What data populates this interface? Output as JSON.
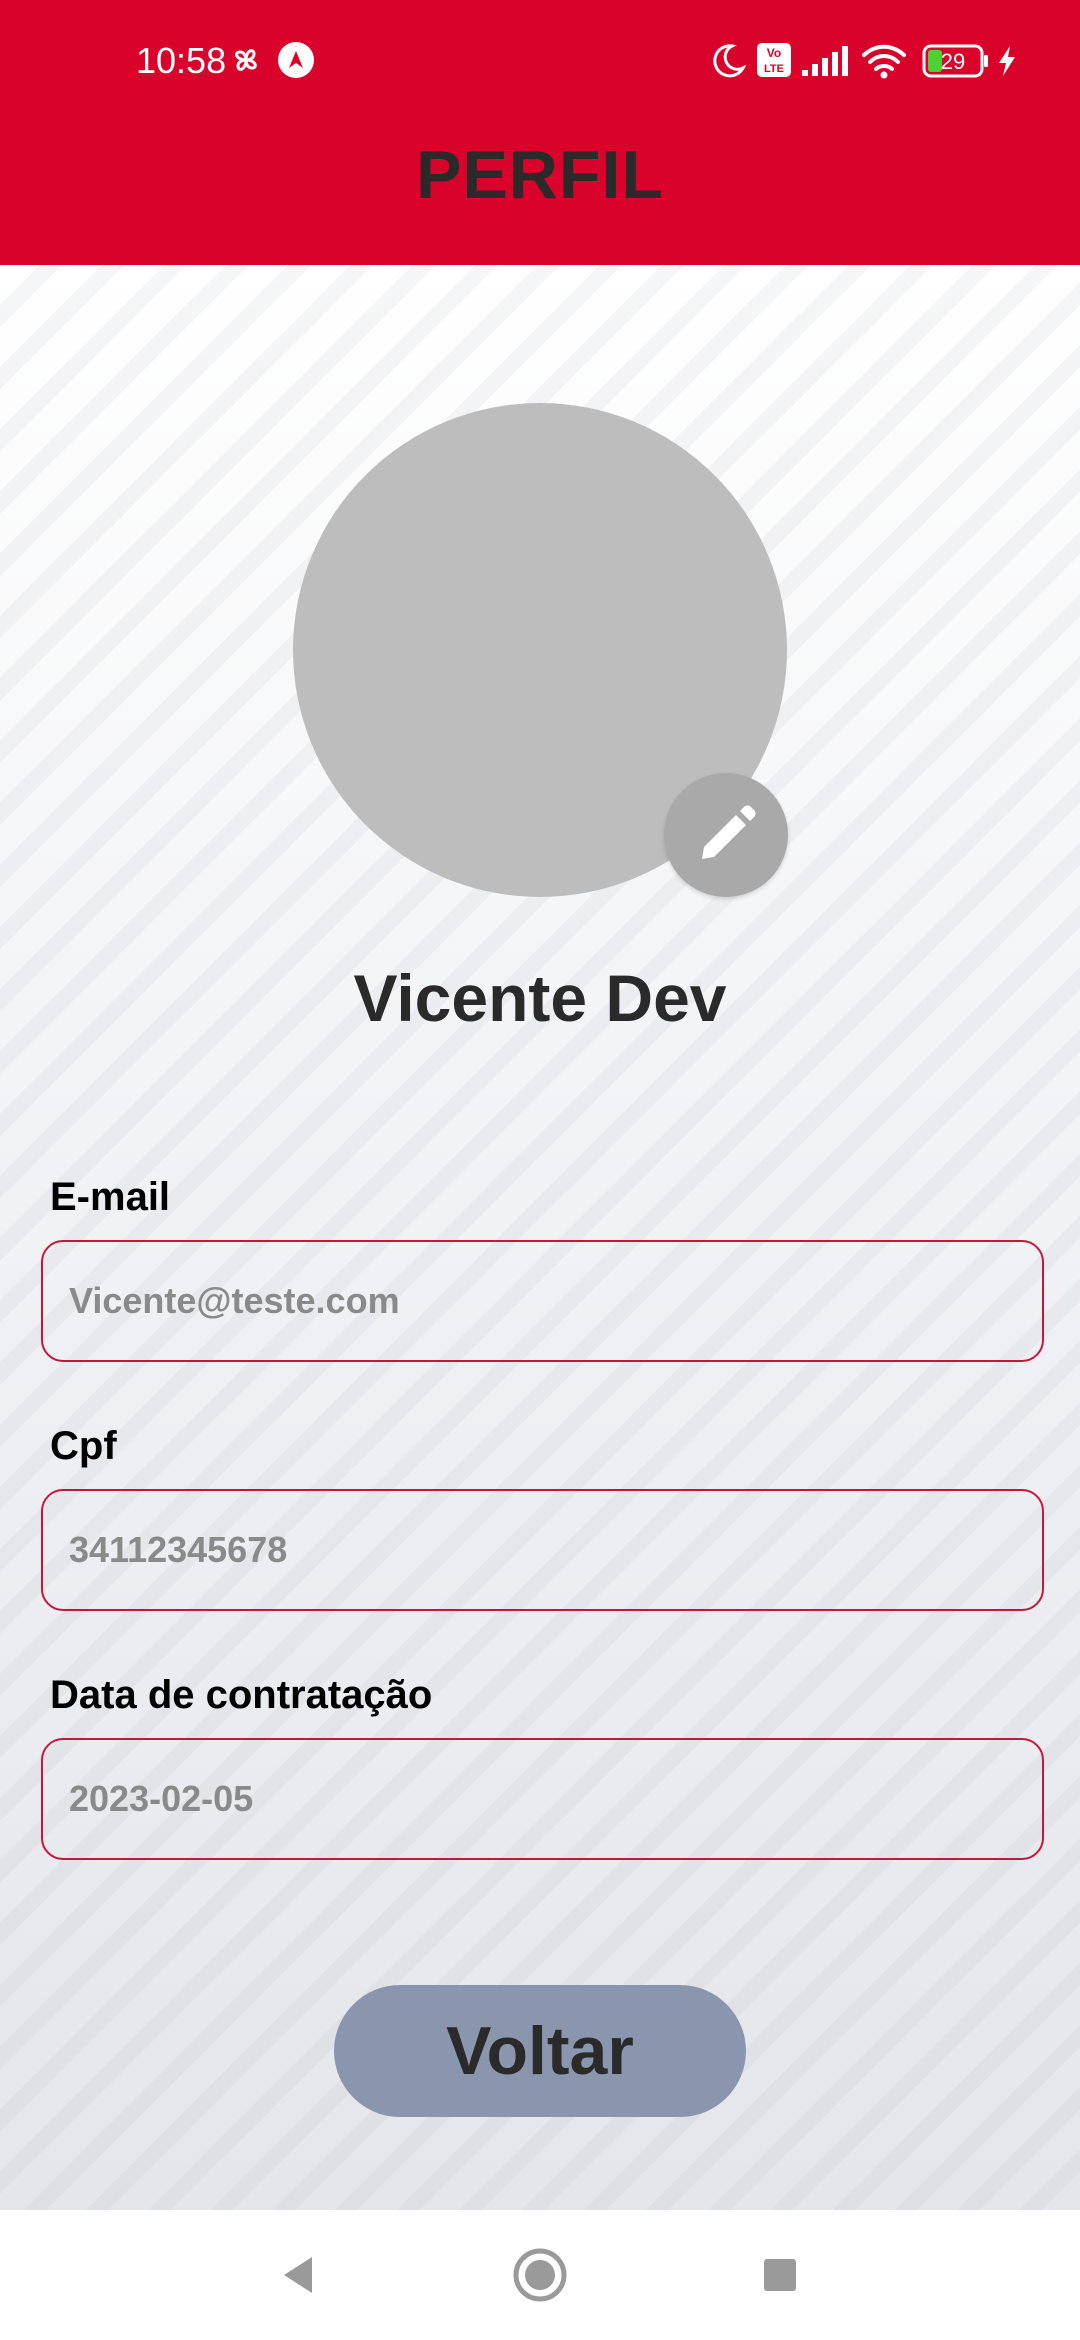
{
  "status_bar": {
    "time": "10:58",
    "battery_level": "29",
    "icons": [
      "pinwheel-icon",
      "navigation-app-icon",
      "moon-icon",
      "volte-icon",
      "signal-icon",
      "wifi-icon",
      "battery-icon",
      "charging-icon"
    ]
  },
  "header": {
    "title": "PERFIL"
  },
  "profile": {
    "name": "Vicente Dev",
    "avatar_color": "#bdbdbd",
    "edit_icon": "pencil-icon"
  },
  "fields": [
    {
      "label": "E-mail",
      "value": "Vicente@teste.com"
    },
    {
      "label": "Cpf",
      "value": "34112345678"
    },
    {
      "label": "Data de contratação",
      "value": "2023-02-05"
    }
  ],
  "actions": {
    "back_label": "Voltar"
  },
  "nav": {
    "icons": [
      "back-triangle-icon",
      "home-circle-icon",
      "recents-square-icon"
    ]
  },
  "colors": {
    "header_bg": "#d8022a",
    "field_border": "#c4173d",
    "button_bg": "#8a96ad",
    "title_text": "#2a2a2a"
  }
}
